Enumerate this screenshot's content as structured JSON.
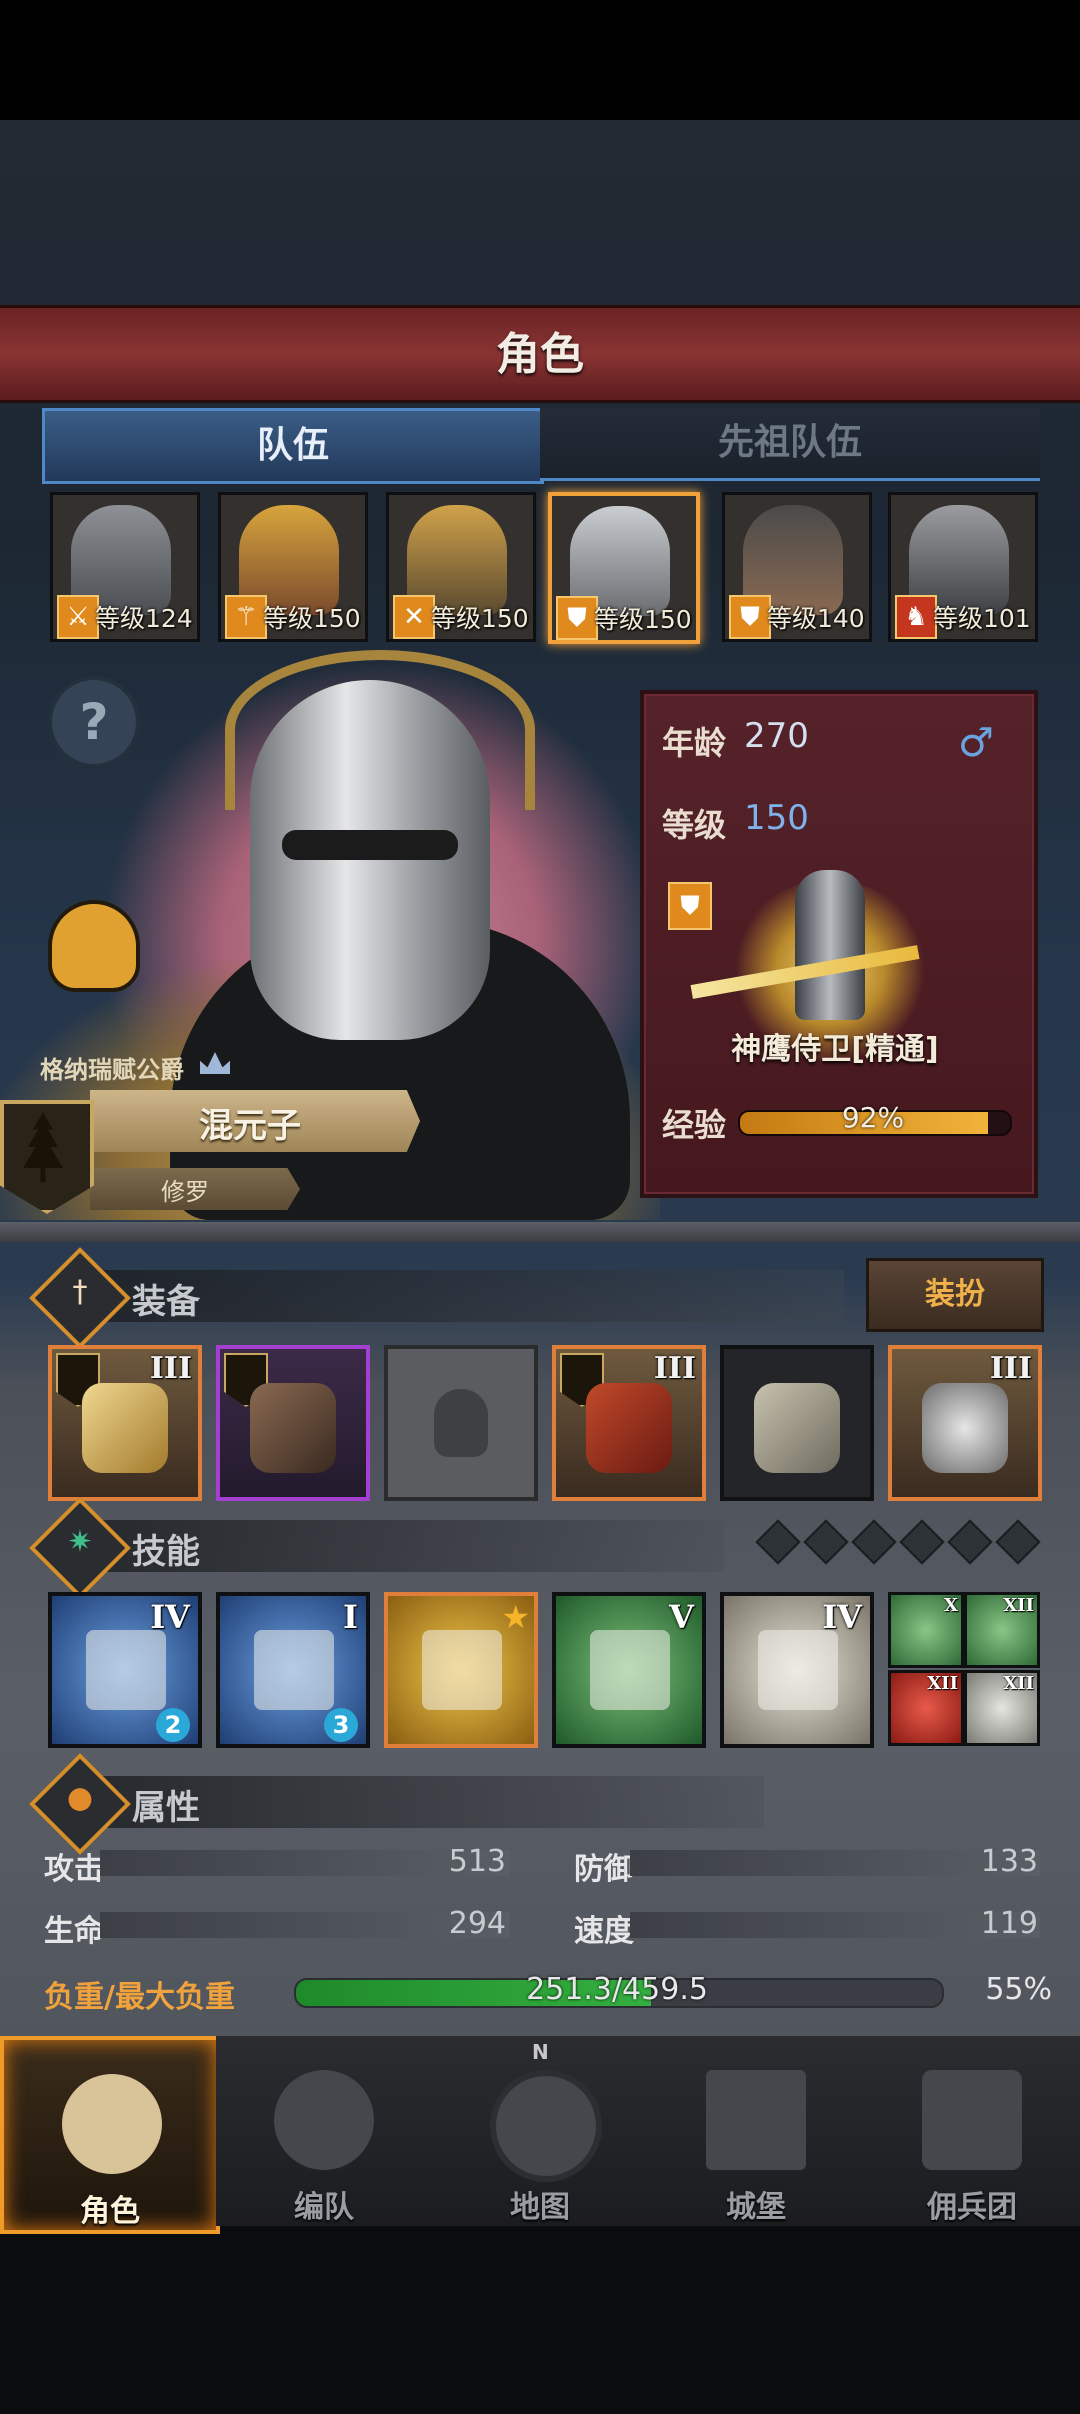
{
  "screen_title": "角色",
  "tabs": {
    "active": "队伍",
    "inactive": "先祖队伍"
  },
  "heroes": [
    {
      "level": "等级124",
      "class_icon": "sword-icon",
      "class_color": "#d88a1e"
    },
    {
      "level": "等级150",
      "class_icon": "staff-icon",
      "class_color": "#d88a1e"
    },
    {
      "level": "等级150",
      "class_icon": "cross-swords-icon",
      "class_color": "#d88a1e"
    },
    {
      "level": "等级150",
      "class_icon": "shield-icon",
      "class_color": "#d88a1e",
      "selected": true
    },
    {
      "level": "等级140",
      "class_icon": "shield-icon",
      "class_color": "#d88a1e"
    },
    {
      "level": "等级101",
      "class_icon": "horse-icon",
      "class_color": "#c4361e"
    }
  ],
  "character": {
    "noble_title": "格纳瑞赋公爵",
    "name": "混元子",
    "subtitle": "修罗"
  },
  "info": {
    "age_label": "年龄",
    "age_value": "270",
    "gender_symbol": "♂",
    "level_label": "等级",
    "level_value": "150",
    "unit_name": "神鹰侍卫[精通]",
    "exp_label": "经验",
    "exp_percent": "92%",
    "exp_fraction": 0.92
  },
  "equipment": {
    "section_label": "装备",
    "dress_button": "装扮",
    "slots": [
      {
        "name": "weapon",
        "tier": "III",
        "rarity": "orange"
      },
      {
        "name": "gauntlet",
        "tier": "",
        "rarity": "purple"
      },
      {
        "name": "helmet",
        "tier": "",
        "rarity": "empty"
      },
      {
        "name": "armor",
        "tier": "III",
        "rarity": "orange"
      },
      {
        "name": "boots",
        "tier": "",
        "rarity": "dark"
      },
      {
        "name": "accessory",
        "tier": "III",
        "rarity": "orange"
      }
    ]
  },
  "skills": {
    "section_label": "技能",
    "slots": [
      {
        "tier": "IV",
        "count": "2",
        "style": "blue"
      },
      {
        "tier": "I",
        "count": "3",
        "style": "blue"
      },
      {
        "tier": "★",
        "count": "",
        "style": "gold"
      },
      {
        "tier": "V",
        "count": "",
        "style": "green"
      },
      {
        "tier": "IV",
        "count": "",
        "style": "white"
      }
    ],
    "mini": [
      {
        "tier": "X",
        "style": "green"
      },
      {
        "tier": "XII",
        "style": "green"
      },
      {
        "tier": "XII",
        "style": "red"
      },
      {
        "tier": "XII",
        "style": "white"
      }
    ],
    "pips": 6
  },
  "attributes": {
    "section_label": "属性",
    "attack_label": "攻击",
    "attack_value": "513",
    "defense_label": "防御",
    "defense_value": "133",
    "hp_label": "生命",
    "hp_value": "294",
    "speed_label": "速度",
    "speed_value": "119",
    "load_label": "负重/最大负重",
    "load_value": "251.3/459.5",
    "load_percent": "55%",
    "load_fraction": 0.55
  },
  "nav": {
    "character": "角色",
    "formation": "编队",
    "map": "地图",
    "map_compass": "N",
    "castle": "城堡",
    "mercenary": "佣兵团"
  },
  "colors": {
    "accent": "#f09a2a",
    "title_bar": "#8a3433",
    "tab_active": "#3b5d86",
    "xp_fill": "#f2b33b",
    "load_fill": "#34b040"
  }
}
